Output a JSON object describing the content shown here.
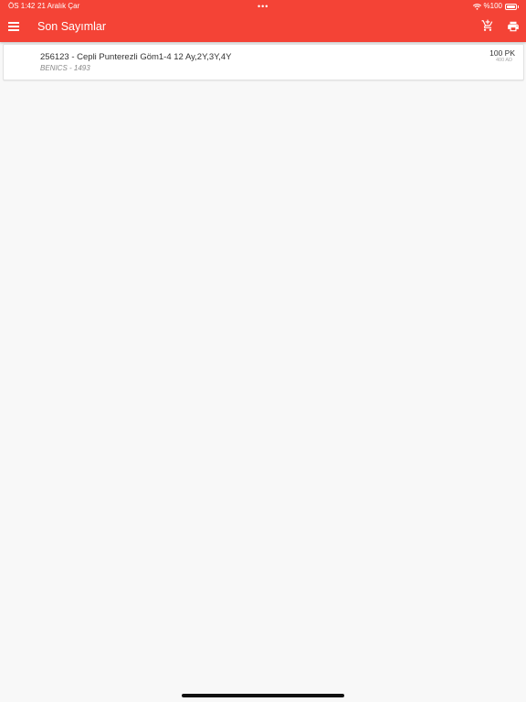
{
  "status_bar": {
    "time": "ÖS 1:42",
    "date": "21 Aralık Çar",
    "dots": "•••",
    "battery_pct": "%100"
  },
  "header": {
    "title": "Son Sayımlar",
    "background": "#f44336"
  },
  "items": [
    {
      "title": "256123 - Cepli Punterezli Göm1-4 12 Ay,2Y,3Y,4Y",
      "subtitle": "BENICS - 1493",
      "quantity": "100 PK",
      "quantity_secondary": "400 AD"
    }
  ]
}
